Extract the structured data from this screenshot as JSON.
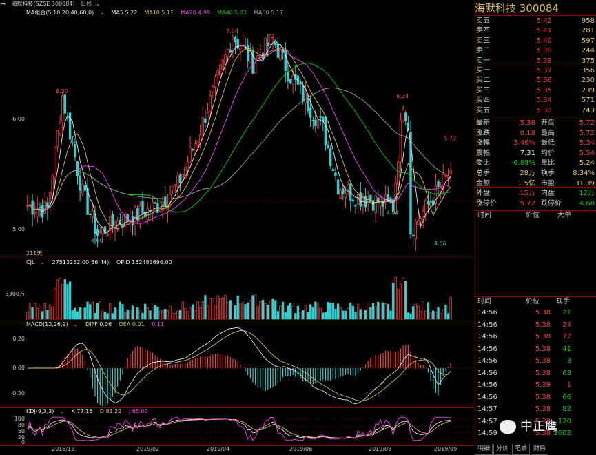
{
  "topbar": {
    "icon": "chain-icon",
    "stock": "海默科技(SZSE 300084)",
    "period": "日线",
    "dropdown": "chevron-down-icon"
  },
  "main": {
    "ma_label": "MA组合(5,10,20,40,60,0)",
    "ma": [
      {
        "t": "MA5 5.22",
        "c": "#e8e8e8"
      },
      {
        "t": "MA10 5.11",
        "c": "#e0c050"
      },
      {
        "t": "MA20 4.99",
        "c": "#ff40ff"
      },
      {
        "t": "MA40 5.03",
        "c": "#00d000"
      },
      {
        "t": "MA60 5.17",
        "c": "#a0a0a0"
      }
    ],
    "yticks": [
      "6.00",
      "5.00"
    ],
    "marks": [
      {
        "t": "6.30",
        "c": "#ff3b3b"
      },
      {
        "t": "4.60",
        "c": "#33c8c8"
      },
      {
        "t": "7.04",
        "c": "#ff3b3b"
      },
      {
        "t": "4.94",
        "c": "#33c8c8"
      },
      {
        "t": "6.24",
        "c": "#ff3b3b"
      },
      {
        "t": "4.56",
        "c": "#33c8c8"
      },
      {
        "t": "5.72",
        "c": "#ff3b3b"
      }
    ],
    "days": "211天"
  },
  "vol": {
    "label": "CJL",
    "v1": "27513252.00(56:44)",
    "v2": "OPID 152483696.00",
    "ytick": "3300万"
  },
  "macd": {
    "label": "MACD(12,26,9)",
    "diff": "DIFF 0.06",
    "dea": "DEA 0.01",
    "m": "0.11",
    "yticks": [
      "0.20",
      "0.00",
      "-0.20"
    ]
  },
  "kdj": {
    "label": "KDJ(9,3,3)",
    "k": "K 77.15",
    "d": "D 83.22",
    "j": "J 65.00",
    "yticks": [
      "100",
      "80",
      "50",
      "20",
      "0"
    ]
  },
  "xaxis": [
    "2018/12",
    "2019/02",
    "2019/04",
    "2019/06",
    "2019/08",
    "2019/09"
  ],
  "right": {
    "title": "海默科技  300084",
    "asks": [
      {
        "l": "卖五",
        "p": "5.42",
        "v": "958"
      },
      {
        "l": "卖四",
        "p": "5.41",
        "v": "281"
      },
      {
        "l": "卖三",
        "p": "5.40",
        "v": "597"
      },
      {
        "l": "卖二",
        "p": "5.39",
        "v": "244"
      },
      {
        "l": "卖一",
        "p": "5.38",
        "v": "375"
      }
    ],
    "bids": [
      {
        "l": "买一",
        "p": "5.37",
        "v": "356"
      },
      {
        "l": "买二",
        "p": "5.36",
        "v": "230"
      },
      {
        "l": "买三",
        "p": "5.35",
        "v": "239"
      },
      {
        "l": "买四",
        "p": "5.34",
        "v": "571"
      },
      {
        "l": "买五",
        "p": "5.33",
        "v": "743"
      }
    ],
    "quote": [
      {
        "l1": "最新",
        "v1": "5.38",
        "c1": "red",
        "l2": "开盘",
        "v2": "5.72",
        "c2": "red"
      },
      {
        "l1": "涨跌",
        "v1": "0.18",
        "c1": "red",
        "l2": "最高",
        "v2": "5.72",
        "c2": "red"
      },
      {
        "l1": "涨幅",
        "v1": "3.46%",
        "c1": "red",
        "l2": "最低",
        "v2": "5.34",
        "c2": "red"
      },
      {
        "l1": "震幅",
        "v1": "7.31",
        "c1": "white",
        "l2": "均价",
        "v2": "5.54",
        "c2": "red"
      },
      {
        "l1": "委比",
        "v1": "-6.88%",
        "c1": "green",
        "l2": "量比",
        "v2": "5.24",
        "c2": "yel"
      },
      {
        "l1": "总手",
        "v1": "28万",
        "c1": "yel",
        "l2": "换手",
        "v2": "8.34%",
        "c2": "yel"
      },
      {
        "l1": "金额",
        "v1": "1.5亿",
        "c1": "yel",
        "l2": "市盈",
        "v2": "31.39",
        "c2": "yel"
      }
    ],
    "quote2": [
      {
        "l1": "外盘",
        "v1": "15万",
        "c1": "red",
        "l2": "内盘",
        "v2": "12万",
        "c2": "green"
      },
      {
        "l1": "涨停价",
        "v1": "5.72",
        "c1": "red",
        "l2": "跌停价",
        "v2": "4.68",
        "c2": "green"
      }
    ],
    "bigorder_headers": [
      "时间",
      "价位",
      "大单"
    ],
    "tick_headers": [
      "时间",
      "价位",
      "现手"
    ],
    "ticks": [
      {
        "t": "14:56",
        "p": "5.38",
        "v": "21",
        "c": "green"
      },
      {
        "t": "14:56",
        "p": "5.38",
        "v": "24",
        "c": "red"
      },
      {
        "t": "14:56",
        "p": "5.38",
        "v": "72",
        "c": "red"
      },
      {
        "t": "14:56",
        "p": "5.38",
        "v": "41",
        "c": "green"
      },
      {
        "t": "14:56",
        "p": "5.38",
        "v": "3",
        "c": "green"
      },
      {
        "t": "14:56",
        "p": "5.38",
        "v": "63",
        "c": "green"
      },
      {
        "t": "14:56",
        "p": "5.39",
        "v": "1",
        "c": "red"
      },
      {
        "t": "14:56",
        "p": "5.38",
        "v": "66",
        "c": "green"
      },
      {
        "t": "14:57",
        "p": "5.38",
        "v": "82",
        "c": "green"
      },
      {
        "t": "14:57",
        "p": "5.38",
        "v": "120",
        "c": "green"
      },
      {
        "t": "14:59",
        "p": "5.38",
        "v": "2602",
        "c": "green"
      }
    ],
    "tabs": [
      "明细",
      "分价",
      "笔录",
      "财务"
    ],
    "watermark": "中正鹰"
  }
}
